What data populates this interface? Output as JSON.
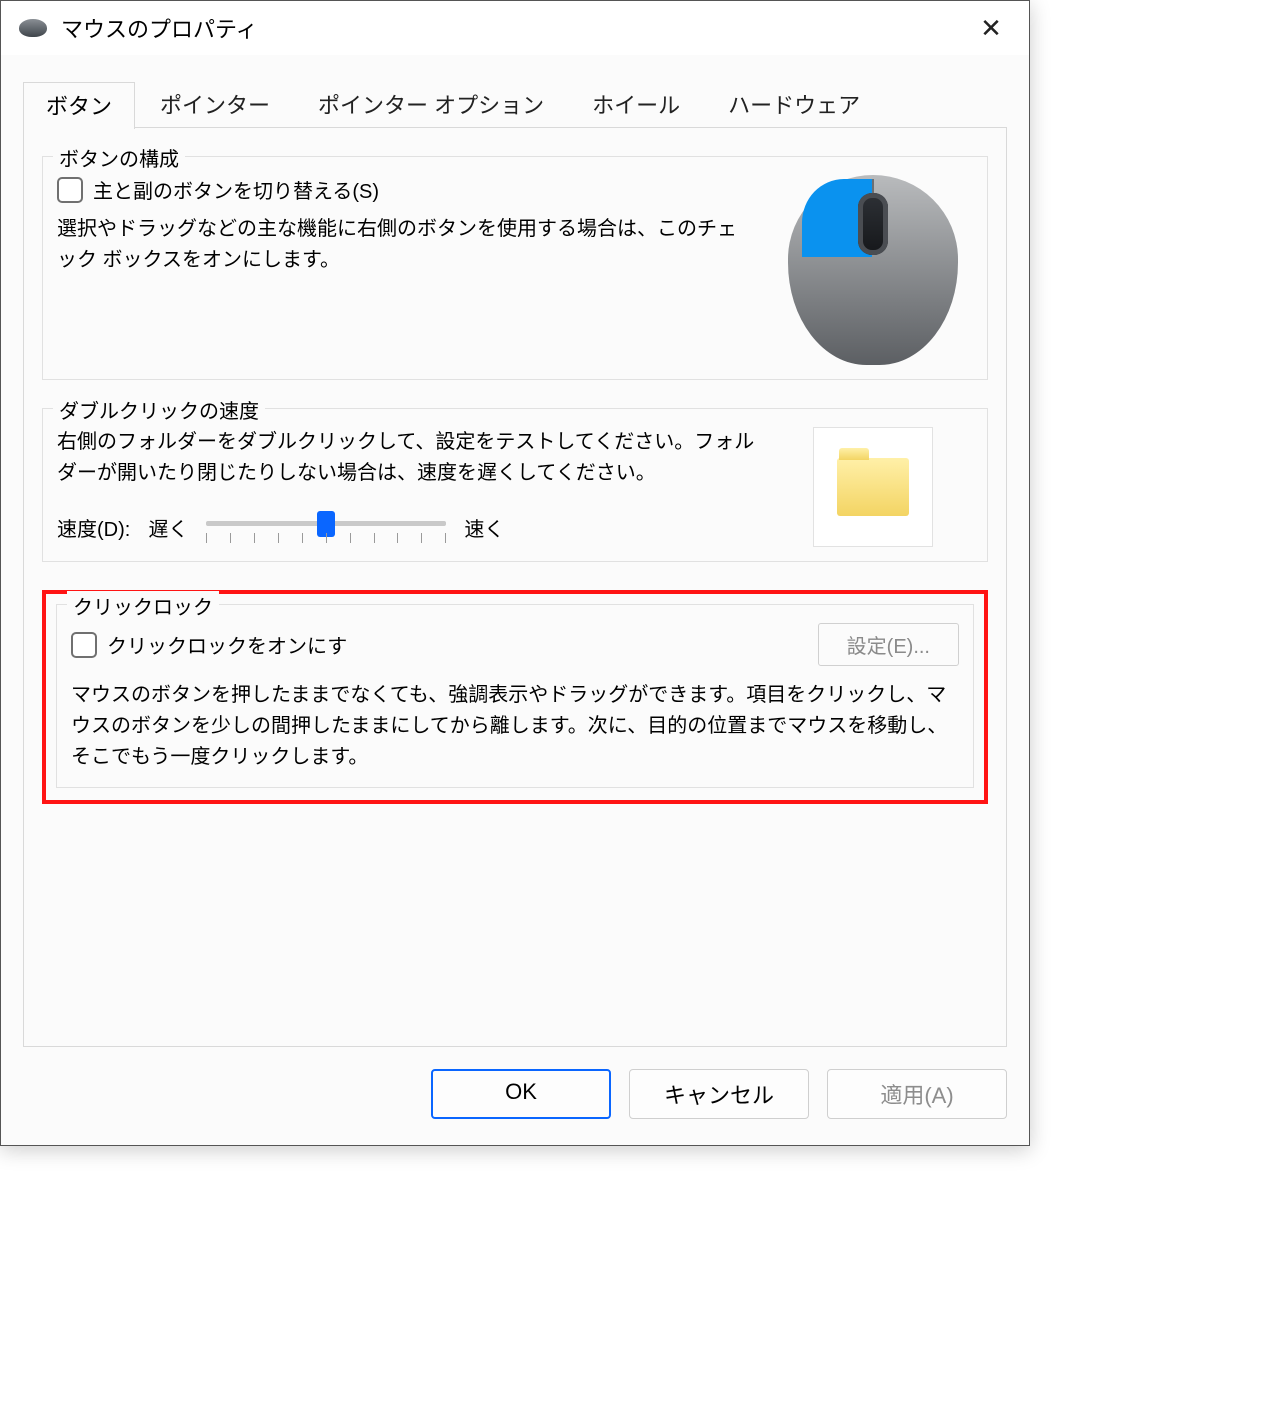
{
  "window": {
    "title": "マウスのプロパティ"
  },
  "tabs": [
    "ボタン",
    "ポインター",
    "ポインター オプション",
    "ホイール",
    "ハードウェア"
  ],
  "active_tab": 0,
  "button_config": {
    "legend": "ボタンの構成",
    "checkbox_label": "主と副のボタンを切り替える(S)",
    "checkbox_checked": false,
    "description": "選択やドラッグなどの主な機能に右側のボタンを使用する場合は、このチェック ボックスをオンにします。"
  },
  "double_click": {
    "legend": "ダブルクリックの速度",
    "description": "右側のフォルダーをダブルクリックして、設定をテストしてください。フォルダーが開いたり閉じたりしない場合は、速度を遅くしてください。",
    "speed_label": "速度(D):",
    "slow_label": "遅く",
    "fast_label": "速く"
  },
  "click_lock": {
    "legend": "クリックロック",
    "checkbox_label": "クリックロックをオンにす",
    "checkbox_checked": false,
    "settings_button": "設定(E)...",
    "description": "マウスのボタンを押したままでなくても、強調表示やドラッグができます。項目をクリックし、マウスのボタンを少しの間押したままにしてから離します。次に、目的の位置までマウスを移動し、そこでもう一度クリックします。"
  },
  "footer": {
    "ok": "OK",
    "cancel": "キャンセル",
    "apply": "適用(A)"
  }
}
